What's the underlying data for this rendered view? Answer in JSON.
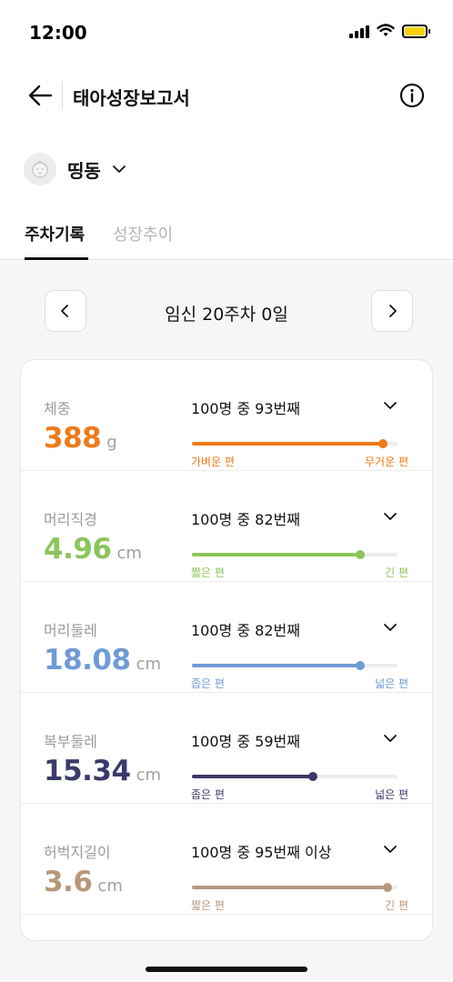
{
  "status_bar": {
    "time": "12:00",
    "battery_color": "#f5d200"
  },
  "nav": {
    "title": "태아성장보고서",
    "back_icon": "arrow-left-icon",
    "info_icon": "info-icon"
  },
  "profile": {
    "name": "띵동",
    "avatar_icon": "baby-face-icon",
    "dropdown_icon": "chevron-down-icon"
  },
  "tabs": [
    {
      "label": "주차기록",
      "active": true
    },
    {
      "label": "성장추이",
      "active": false
    }
  ],
  "week": {
    "label": "임신 20주차 0일",
    "prev_icon": "chevron-left-icon",
    "next_icon": "chevron-right-icon"
  },
  "metrics": [
    {
      "label": "체중",
      "value": "388",
      "unit": "g",
      "rank": "100명 중 93번째",
      "low": "가벼운 편",
      "high": "무거운 편",
      "percentile": 0.93,
      "color": "#ef7a1a",
      "track_label_color": "#ef7a1a"
    },
    {
      "label": "머리직경",
      "value": "4.96",
      "unit": "cm",
      "rank": "100명 중 82번째",
      "low": "짧은 편",
      "high": "긴 편",
      "percentile": 0.82,
      "color": "#8cc45a",
      "track_label_color": "#8cc45a"
    },
    {
      "label": "머리둘레",
      "value": "18.08",
      "unit": "cm",
      "rank": "100명 중 82번째",
      "low": "좁은 편",
      "high": "넓은 편",
      "percentile": 0.82,
      "color": "#6f9bd6",
      "track_label_color": "#6f9bd6"
    },
    {
      "label": "복부둘레",
      "value": "15.34",
      "unit": "cm",
      "rank": "100명 중 59번째",
      "low": "좁은 편",
      "high": "넓은 편",
      "percentile": 0.59,
      "color": "#3b3a6b",
      "track_label_color": "#3b3a6b"
    },
    {
      "label": "허벅지길이",
      "value": "3.6",
      "unit": "cm",
      "rank": "100명 중 95번째 이상",
      "low": "짧은 편",
      "high": "긴 편",
      "percentile": 0.95,
      "color": "#b8977a",
      "track_label_color": "#b8977a"
    }
  ]
}
